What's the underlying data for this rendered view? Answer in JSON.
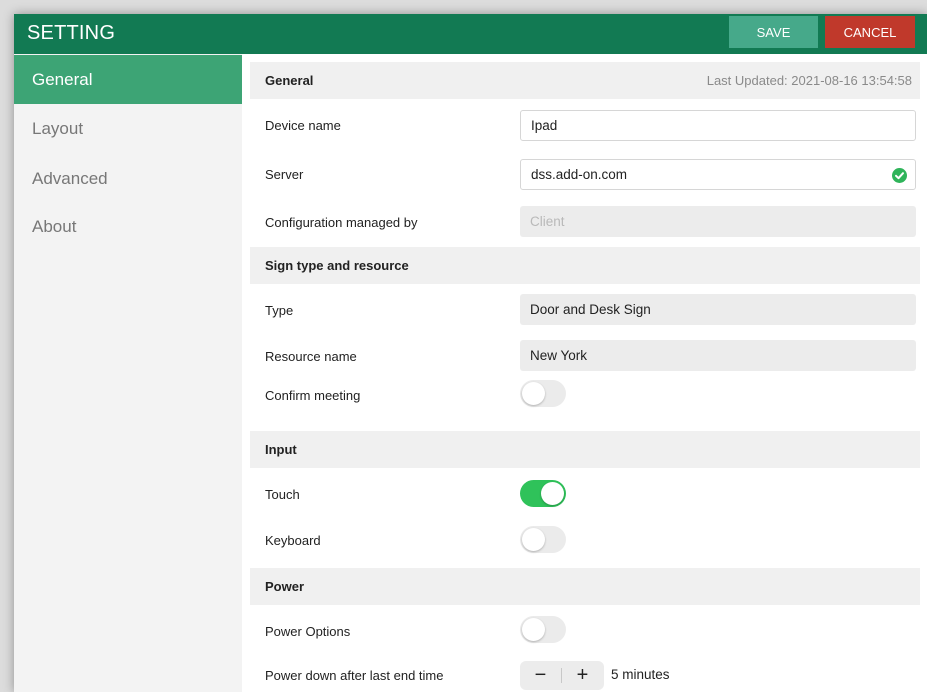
{
  "header": {
    "title": "SETTING",
    "save_label": "SAVE",
    "cancel_label": "CANCEL"
  },
  "sidebar": {
    "items": [
      {
        "label": "General",
        "active": true
      },
      {
        "label": "Layout",
        "active": false
      },
      {
        "label": "Advanced",
        "active": false
      },
      {
        "label": "About",
        "active": false
      }
    ]
  },
  "general": {
    "heading": "General",
    "last_updated": "Last Updated: 2021-08-16 13:54:58",
    "device_name_label": "Device name",
    "device_name_value": "Ipad",
    "server_label": "Server",
    "server_value": "dss.add-on.com",
    "server_status_icon": "check-circle-icon",
    "config_label": "Configuration managed by",
    "config_value": "Client"
  },
  "sign": {
    "heading": "Sign type and resource",
    "type_label": "Type",
    "type_value": "Door and Desk Sign",
    "resource_label": "Resource name",
    "resource_value": "New York",
    "confirm_label": "Confirm meeting",
    "confirm_on": false
  },
  "input": {
    "heading": "Input",
    "touch_label": "Touch",
    "touch_on": true,
    "keyboard_label": "Keyboard",
    "keyboard_on": false
  },
  "power": {
    "heading": "Power",
    "options_label": "Power Options",
    "options_on": false,
    "down_label": "Power down after last end time",
    "minus_label": "−",
    "plus_label": "+",
    "down_value": "5 minutes"
  },
  "colors": {
    "header": "#127a53",
    "active": "#3da475",
    "save": "#46a98a",
    "cancel": "#c0392b",
    "toggle_on": "#2fc25a"
  }
}
